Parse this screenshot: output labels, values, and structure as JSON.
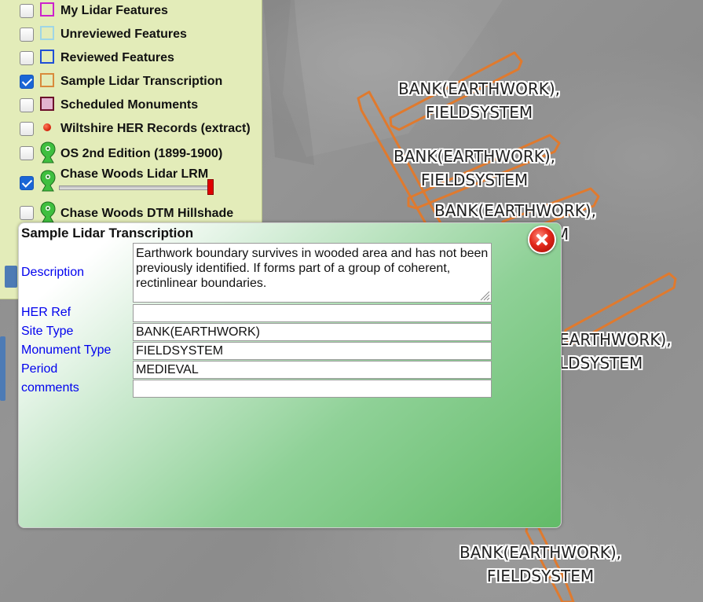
{
  "layers": [
    {
      "label": "My Lidar Features",
      "checked": false,
      "symbol": "swatch",
      "color": "#cc22cc",
      "fill": "none"
    },
    {
      "label": "Unreviewed Features",
      "checked": false,
      "symbol": "swatch",
      "color": "#9fd6e6",
      "fill": "none"
    },
    {
      "label": "Reviewed Features",
      "checked": false,
      "symbol": "swatch",
      "color": "#1f4fd6",
      "fill": "none"
    },
    {
      "label": "Sample Lidar Transcription",
      "checked": true,
      "symbol": "swatch",
      "color": "#d98a3c",
      "fill": "none"
    },
    {
      "label": "Scheduled Monuments",
      "checked": false,
      "symbol": "swatch",
      "color": "#6b0f2a",
      "fill": "#e3b4d0"
    },
    {
      "label": "Wiltshire HER Records (extract)",
      "checked": false,
      "symbol": "red-dot",
      "color": "#e02a10"
    },
    {
      "label": "OS 2nd Edition (1899-1900)",
      "checked": false,
      "symbol": "map-pin-icon",
      "color": "#3fbf3f"
    },
    {
      "label": "Chase Woods Lidar LRM",
      "checked": true,
      "symbol": "map-pin-icon",
      "color": "#3fbf3f",
      "opacity_slider": 0.97
    },
    {
      "label": "Chase Woods DTM Hillshade",
      "checked": false,
      "symbol": "map-pin-icon",
      "color": "#3fbf3f"
    }
  ],
  "map": {
    "feature_color": "#e07a2e",
    "labels": [
      {
        "line1": "BANK(EARTHWORK),",
        "line2": "FIELDSYSTEM"
      },
      {
        "line1": "BANK(EARTHWORK),",
        "line2": "FIELDSYSTEM"
      },
      {
        "line1": "BANK(EARTHWORK),",
        "line2": "FIELDSYSTEM"
      },
      {
        "line1": "EARTHWORK),",
        "line2": "LDSYSTEM"
      },
      {
        "line1": "BANK(EARTHWORK),",
        "line2": "FIELDSYSTEM"
      }
    ]
  },
  "popup": {
    "title": "Sample Lidar Transcription",
    "fields": {
      "description": {
        "label": "Description",
        "value": "Earthwork boundary survives in wooded area and has not been previously identified. If forms part of a group of coherent, rectinlinear boundaries."
      },
      "her_ref": {
        "label": "HER Ref",
        "value": ""
      },
      "site_type": {
        "label": "Site Type",
        "value": "BANK(EARTHWORK)"
      },
      "monument_type": {
        "label": "Monument Type",
        "value": "FIELDSYSTEM"
      },
      "period": {
        "label": "Period",
        "value": "MEDIEVAL"
      },
      "comments": {
        "label": "comments",
        "value": ""
      }
    }
  }
}
